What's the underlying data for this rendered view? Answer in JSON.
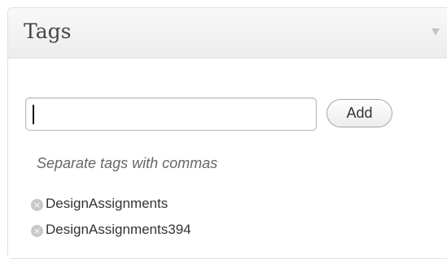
{
  "panel": {
    "title": "Tags",
    "toggle_icon": "triangle-down-icon"
  },
  "tag_input": {
    "value": "",
    "placeholder": ""
  },
  "add_button": {
    "label": "Add"
  },
  "hint": "Separate tags with commas",
  "tags": [
    {
      "label": "DesignAssignments",
      "remove_icon": "remove-x-icon"
    },
    {
      "label": "DesignAssignments394",
      "remove_icon": "remove-x-icon"
    }
  ]
}
